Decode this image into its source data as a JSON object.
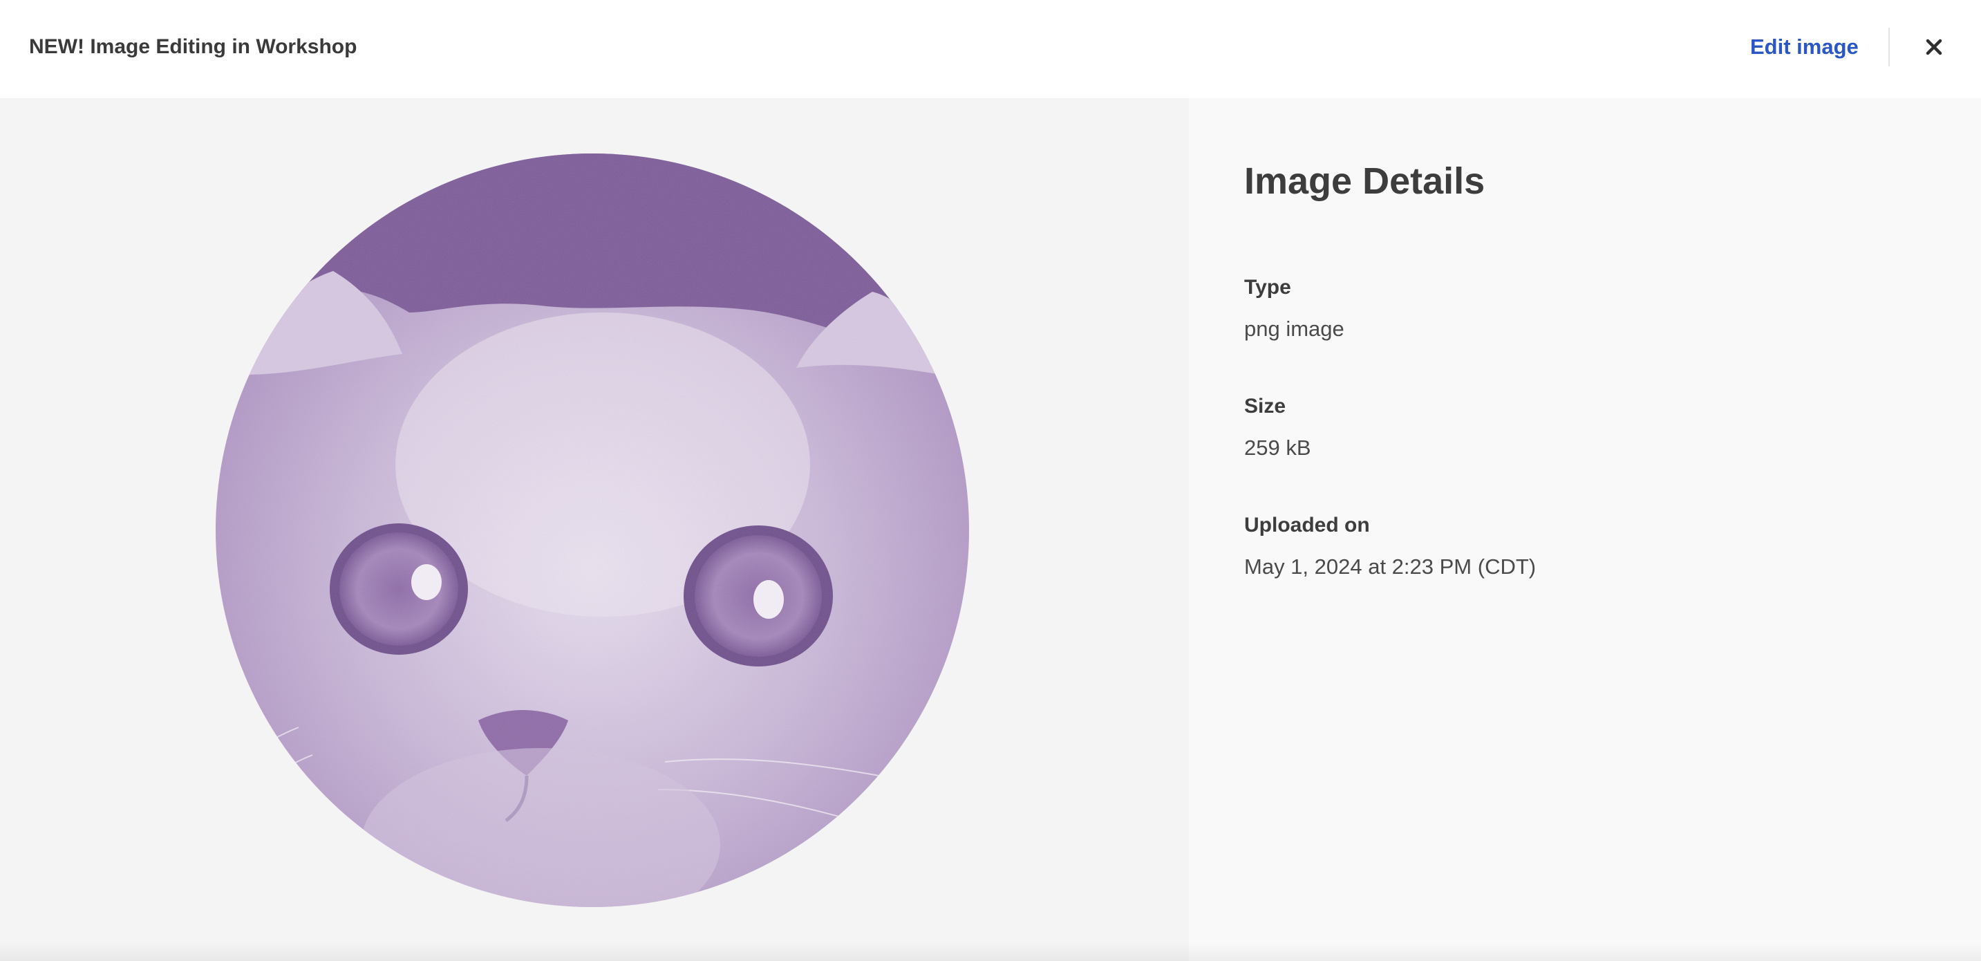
{
  "header": {
    "title": "NEW! Image Editing in Workshop",
    "edit_label": "Edit image",
    "close_icon": "close-icon",
    "link_color": "#2a56c6"
  },
  "preview": {
    "subject": "kitten face",
    "tint_color": "#7b5a96"
  },
  "details": {
    "title": "Image Details",
    "type_label": "Type",
    "type_value": "png image",
    "size_label": "Size",
    "size_value": "259 kB",
    "uploaded_label": "Uploaded on",
    "uploaded_value": "May 1, 2024 at 2:23 PM (CDT)"
  }
}
